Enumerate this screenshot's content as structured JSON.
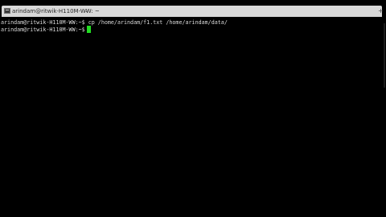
{
  "window": {
    "tab_title": "arindam@ritwik-H110M-WW: ~",
    "tab_caret": "⌄",
    "new_tab": "+",
    "tab_icon": "terminal-icon"
  },
  "terminal": {
    "line1_prompt": "arindam@ritwik-H110M-WW:~$",
    "line1_command": " cp /home/arindam/f1.txt /home/arindam/data/",
    "line2_prompt": "arindam@ritwik-H110M-WW:~$",
    "cursor_color": "#22dd22",
    "text_color": "#d8d8d8",
    "background": "#000000"
  }
}
